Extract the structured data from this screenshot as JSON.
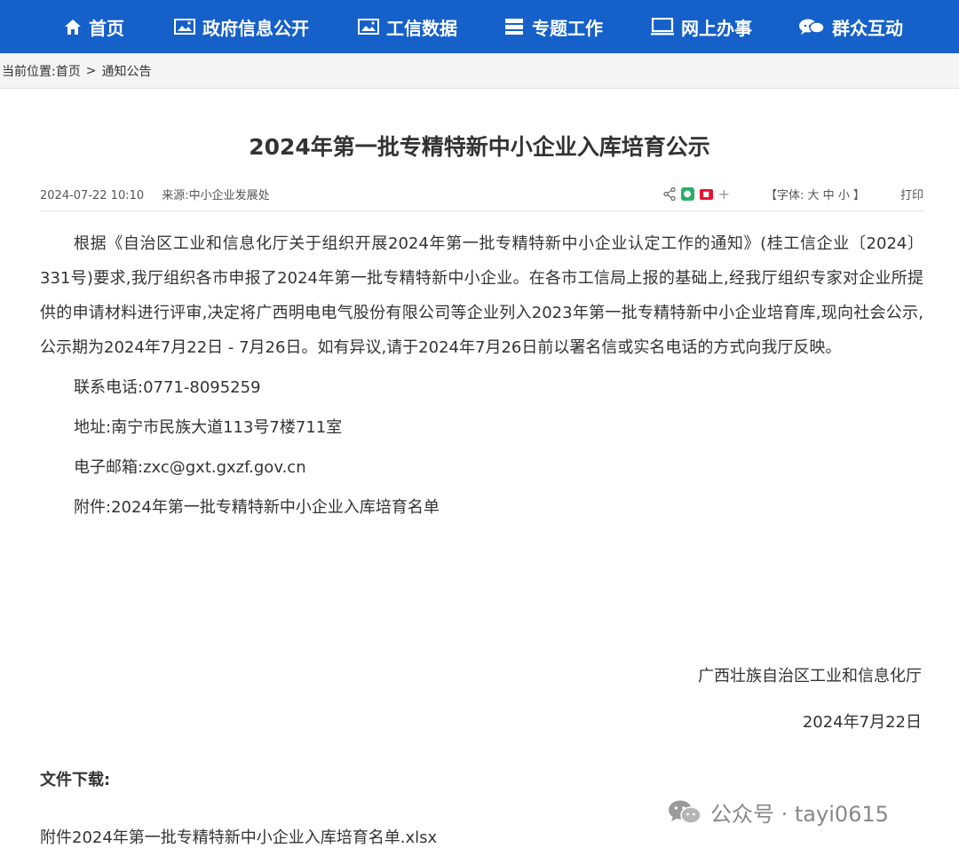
{
  "nav": {
    "items": [
      {
        "label": "首页",
        "icon": "home-icon"
      },
      {
        "label": "政府信息公开",
        "icon": "image-icon"
      },
      {
        "label": "工信数据",
        "icon": "image-icon"
      },
      {
        "label": "专题工作",
        "icon": "stack-icon"
      },
      {
        "label": "网上办事",
        "icon": "monitor-icon"
      },
      {
        "label": "群众互动",
        "icon": "chat-icon"
      }
    ]
  },
  "breadcrumb": {
    "prefix": "当前位置:",
    "home": "首页",
    "sep": ">",
    "current": "通知公告"
  },
  "article": {
    "title": "2024年第一批专精特新中小企业入库培育公示",
    "date": "2024-07-22 10:10",
    "source": "来源:中小企业发展处",
    "font_label": "【字体:",
    "font_large": "大",
    "font_medium": "中",
    "font_small": "小",
    "font_close": "】",
    "print_label": "打印",
    "body": "根据《自治区工业和信息化厅关于组织开展2024年第一批专精特新中小企业认定工作的通知》(桂工信企业〔2024〕331号)要求,我厅组织各市申报了2024年第一批专精特新中小企业。在各市工信局上报的基础上,经我厅组织专家对企业所提供的申请材料进行评审,决定将广西明电电气股份有限公司等企业列入2023年第一批专精特新中小企业培育库,现向社会公示,公示期为2024年7月22日 - 7月26日。如有异议,请于2024年7月26日前以署名信或实名电话的方式向我厅反映。",
    "phone": "联系电话:0771-8095259",
    "address": "地址:南宁市民族大道113号7楼711室",
    "email": "电子邮箱:zxc@gxt.gxzf.gov.cn",
    "attachment": "附件:2024年第一批专精特新中小企业入库培育名单",
    "signer": "广西壮族自治区工业和信息化厅",
    "sign_date": "2024年7月22日"
  },
  "downloads": {
    "heading": "文件下载:",
    "file": "附件2024年第一批专精特新中小企业入库培育名单.xlsx"
  },
  "watermark": {
    "text": "公众号 · tayi0615"
  },
  "colors": {
    "nav_bg": "#1560c9",
    "wechat": "#2aae67",
    "weibo": "#e6162d"
  }
}
